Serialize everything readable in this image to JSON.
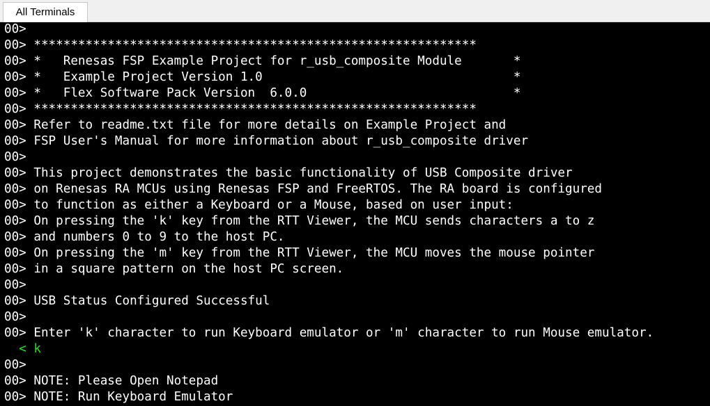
{
  "tab": {
    "label": "All Terminals"
  },
  "terminal": {
    "lines": [
      {
        "text": "00>",
        "kind": "output"
      },
      {
        "text": "00> ************************************************************",
        "kind": "output"
      },
      {
        "text": "00> *   Renesas FSP Example Project for r_usb_composite Module       *",
        "kind": "output"
      },
      {
        "text": "00> *   Example Project Version 1.0                                  *",
        "kind": "output"
      },
      {
        "text": "00> *   Flex Software Pack Version  6.0.0                            *",
        "kind": "output"
      },
      {
        "text": "00> ************************************************************",
        "kind": "output"
      },
      {
        "text": "00> Refer to readme.txt file for more details on Example Project and",
        "kind": "output"
      },
      {
        "text": "00> FSP User's Manual for more information about r_usb_composite driver",
        "kind": "output"
      },
      {
        "text": "00>",
        "kind": "output"
      },
      {
        "text": "00> This project demonstrates the basic functionality of USB Composite driver",
        "kind": "output"
      },
      {
        "text": "00> on Renesas RA MCUs using Renesas FSP and FreeRTOS. The RA board is configured",
        "kind": "output"
      },
      {
        "text": "00> to function as either a Keyboard or a Mouse, based on user input:",
        "kind": "output"
      },
      {
        "text": "00> On pressing the 'k' key from the RTT Viewer, the MCU sends characters a to z",
        "kind": "output"
      },
      {
        "text": "00> and numbers 0 to 9 to the host PC.",
        "kind": "output"
      },
      {
        "text": "00> On pressing the 'm' key from the RTT Viewer, the MCU moves the mouse pointer",
        "kind": "output"
      },
      {
        "text": "00> in a square pattern on the host PC screen.",
        "kind": "output"
      },
      {
        "text": "00>",
        "kind": "output"
      },
      {
        "text": "00> USB Status Configured Successful",
        "kind": "output"
      },
      {
        "text": "00>",
        "kind": "output"
      },
      {
        "text": "00> Enter 'k' character to run Keyboard emulator or 'm' character to run Mouse emulator.",
        "kind": "output"
      },
      {
        "text": "  < k",
        "kind": "input"
      },
      {
        "text": "00>",
        "kind": "output"
      },
      {
        "text": "00> NOTE: Please Open Notepad",
        "kind": "output"
      },
      {
        "text": "00> NOTE: Run Keyboard Emulator",
        "kind": "output"
      }
    ]
  },
  "colors": {
    "background": "#000000",
    "output_text": "#ffffff",
    "input_text": "#22e022",
    "tab_bar": "#f0f0f0"
  }
}
